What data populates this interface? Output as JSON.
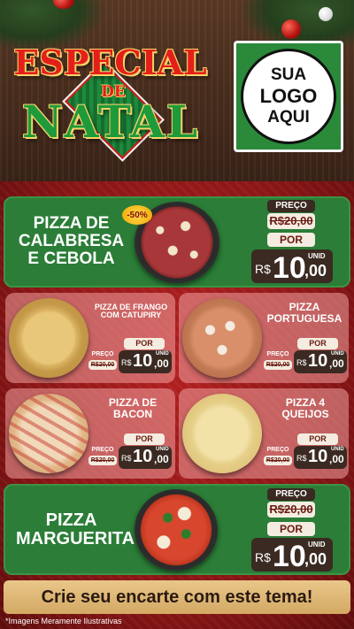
{
  "header": {
    "title_line1": "ESPECIAL",
    "title_connector": "DE",
    "title_line2": "NATAL",
    "logo_line1": "SUA",
    "logo_line2": "LOGO",
    "logo_line3": "AQUI"
  },
  "labels": {
    "preco": "PREÇO",
    "por": "POR",
    "unid": "UNID",
    "currency": "R$"
  },
  "products": {
    "calabresa": {
      "name_line1": "PIZZA DE",
      "name_line2": "CALABRESA",
      "name_line3": "E CEBOLA",
      "old_price": "R$20,00",
      "price_int": "10",
      "price_dec": ",00",
      "badge": "-50%"
    },
    "frango": {
      "name_line1": "PIZZA DE FRANGO",
      "name_line2": "COM CATUPIRY",
      "old_price": "R$20,00",
      "price_int": "10",
      "price_dec": ",00"
    },
    "portuguesa": {
      "name_line1": "PIZZA",
      "name_line2": "PORTUGUESA",
      "old_price": "R$20,00",
      "price_int": "10",
      "price_dec": ",00"
    },
    "bacon": {
      "name_line1": "PIZZA DE",
      "name_line2": "BACON",
      "old_price": "R$20,00",
      "price_int": "10",
      "price_dec": ",00"
    },
    "queijos": {
      "name_line1": "PIZZA 4",
      "name_line2": "QUEIJOS",
      "old_price": "R$20,00",
      "price_int": "10",
      "price_dec": ",00"
    },
    "marguerita": {
      "name_line1": "PIZZA",
      "name_line2": "MARGUERITA",
      "old_price": "R$20,00",
      "price_int": "10",
      "price_dec": ",00"
    }
  },
  "banner": "Crie seu encarte com este tema!",
  "footnote": "*Imagens Meramente Ilustrativas",
  "colors": {
    "accent_red": "#e41f1a",
    "accent_green": "#2b7d37",
    "price_dark": "#3a2a22",
    "banner_gold": "#d3a863"
  }
}
